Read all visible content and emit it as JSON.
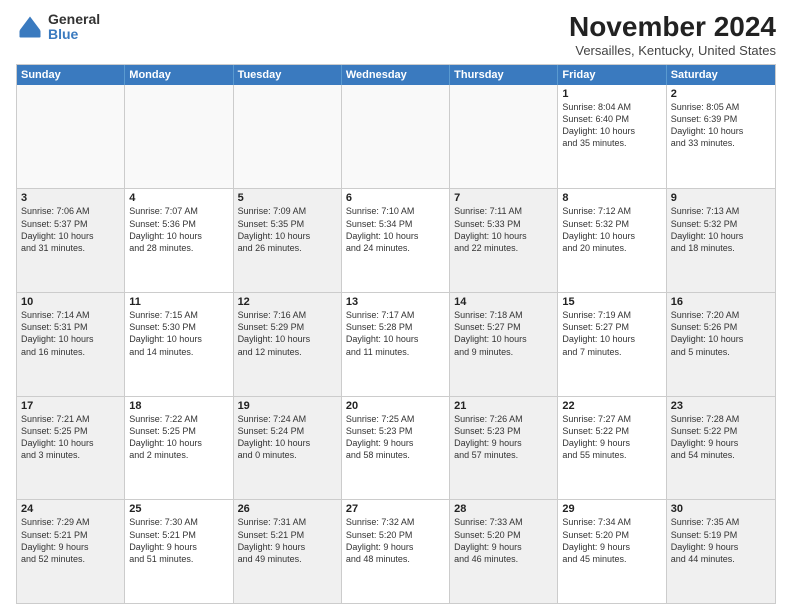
{
  "header": {
    "logo_general": "General",
    "logo_blue": "Blue",
    "title": "November 2024",
    "subtitle": "Versailles, Kentucky, United States"
  },
  "days_of_week": [
    "Sunday",
    "Monday",
    "Tuesday",
    "Wednesday",
    "Thursday",
    "Friday",
    "Saturday"
  ],
  "weeks": [
    [
      {
        "day": "",
        "empty": true
      },
      {
        "day": "",
        "empty": true
      },
      {
        "day": "",
        "empty": true
      },
      {
        "day": "",
        "empty": true
      },
      {
        "day": "",
        "empty": true
      },
      {
        "day": "1",
        "info": "Sunrise: 8:04 AM\nSunset: 6:40 PM\nDaylight: 10 hours\nand 35 minutes."
      },
      {
        "day": "2",
        "info": "Sunrise: 8:05 AM\nSunset: 6:39 PM\nDaylight: 10 hours\nand 33 minutes."
      }
    ],
    [
      {
        "day": "3",
        "info": "Sunrise: 7:06 AM\nSunset: 5:37 PM\nDaylight: 10 hours\nand 31 minutes.",
        "shaded": true
      },
      {
        "day": "4",
        "info": "Sunrise: 7:07 AM\nSunset: 5:36 PM\nDaylight: 10 hours\nand 28 minutes."
      },
      {
        "day": "5",
        "info": "Sunrise: 7:09 AM\nSunset: 5:35 PM\nDaylight: 10 hours\nand 26 minutes.",
        "shaded": true
      },
      {
        "day": "6",
        "info": "Sunrise: 7:10 AM\nSunset: 5:34 PM\nDaylight: 10 hours\nand 24 minutes."
      },
      {
        "day": "7",
        "info": "Sunrise: 7:11 AM\nSunset: 5:33 PM\nDaylight: 10 hours\nand 22 minutes.",
        "shaded": true
      },
      {
        "day": "8",
        "info": "Sunrise: 7:12 AM\nSunset: 5:32 PM\nDaylight: 10 hours\nand 20 minutes."
      },
      {
        "day": "9",
        "info": "Sunrise: 7:13 AM\nSunset: 5:32 PM\nDaylight: 10 hours\nand 18 minutes.",
        "shaded": true
      }
    ],
    [
      {
        "day": "10",
        "info": "Sunrise: 7:14 AM\nSunset: 5:31 PM\nDaylight: 10 hours\nand 16 minutes.",
        "shaded": true
      },
      {
        "day": "11",
        "info": "Sunrise: 7:15 AM\nSunset: 5:30 PM\nDaylight: 10 hours\nand 14 minutes."
      },
      {
        "day": "12",
        "info": "Sunrise: 7:16 AM\nSunset: 5:29 PM\nDaylight: 10 hours\nand 12 minutes.",
        "shaded": true
      },
      {
        "day": "13",
        "info": "Sunrise: 7:17 AM\nSunset: 5:28 PM\nDaylight: 10 hours\nand 11 minutes."
      },
      {
        "day": "14",
        "info": "Sunrise: 7:18 AM\nSunset: 5:27 PM\nDaylight: 10 hours\nand 9 minutes.",
        "shaded": true
      },
      {
        "day": "15",
        "info": "Sunrise: 7:19 AM\nSunset: 5:27 PM\nDaylight: 10 hours\nand 7 minutes."
      },
      {
        "day": "16",
        "info": "Sunrise: 7:20 AM\nSunset: 5:26 PM\nDaylight: 10 hours\nand 5 minutes.",
        "shaded": true
      }
    ],
    [
      {
        "day": "17",
        "info": "Sunrise: 7:21 AM\nSunset: 5:25 PM\nDaylight: 10 hours\nand 3 minutes.",
        "shaded": true
      },
      {
        "day": "18",
        "info": "Sunrise: 7:22 AM\nSunset: 5:25 PM\nDaylight: 10 hours\nand 2 minutes."
      },
      {
        "day": "19",
        "info": "Sunrise: 7:24 AM\nSunset: 5:24 PM\nDaylight: 10 hours\nand 0 minutes.",
        "shaded": true
      },
      {
        "day": "20",
        "info": "Sunrise: 7:25 AM\nSunset: 5:23 PM\nDaylight: 9 hours\nand 58 minutes."
      },
      {
        "day": "21",
        "info": "Sunrise: 7:26 AM\nSunset: 5:23 PM\nDaylight: 9 hours\nand 57 minutes.",
        "shaded": true
      },
      {
        "day": "22",
        "info": "Sunrise: 7:27 AM\nSunset: 5:22 PM\nDaylight: 9 hours\nand 55 minutes."
      },
      {
        "day": "23",
        "info": "Sunrise: 7:28 AM\nSunset: 5:22 PM\nDaylight: 9 hours\nand 54 minutes.",
        "shaded": true
      }
    ],
    [
      {
        "day": "24",
        "info": "Sunrise: 7:29 AM\nSunset: 5:21 PM\nDaylight: 9 hours\nand 52 minutes.",
        "shaded": true
      },
      {
        "day": "25",
        "info": "Sunrise: 7:30 AM\nSunset: 5:21 PM\nDaylight: 9 hours\nand 51 minutes."
      },
      {
        "day": "26",
        "info": "Sunrise: 7:31 AM\nSunset: 5:21 PM\nDaylight: 9 hours\nand 49 minutes.",
        "shaded": true
      },
      {
        "day": "27",
        "info": "Sunrise: 7:32 AM\nSunset: 5:20 PM\nDaylight: 9 hours\nand 48 minutes."
      },
      {
        "day": "28",
        "info": "Sunrise: 7:33 AM\nSunset: 5:20 PM\nDaylight: 9 hours\nand 46 minutes.",
        "shaded": true
      },
      {
        "day": "29",
        "info": "Sunrise: 7:34 AM\nSunset: 5:20 PM\nDaylight: 9 hours\nand 45 minutes."
      },
      {
        "day": "30",
        "info": "Sunrise: 7:35 AM\nSunset: 5:19 PM\nDaylight: 9 hours\nand 44 minutes.",
        "shaded": true
      }
    ]
  ]
}
